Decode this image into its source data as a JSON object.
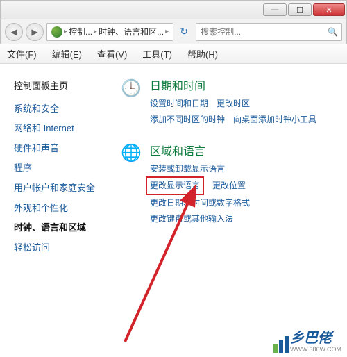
{
  "titlebar": {
    "min": "—",
    "max": "☐",
    "close": "✕"
  },
  "nav": {
    "back": "◀",
    "fwd": "▶",
    "bc1": "控制...",
    "bc2": "时钟、语言和区...",
    "refresh": "↻",
    "search_ph": "搜索控制..."
  },
  "menu": {
    "file": "文件(F)",
    "edit": "编辑(E)",
    "view": "查看(V)",
    "tools": "工具(T)",
    "help": "帮助(H)"
  },
  "sidebar": {
    "home": "控制面板主页",
    "items": [
      {
        "label": "系统和安全"
      },
      {
        "label": "网络和 Internet"
      },
      {
        "label": "硬件和声音"
      },
      {
        "label": "程序"
      },
      {
        "label": "用户帐户和家庭安全"
      },
      {
        "label": "外观和个性化"
      },
      {
        "label": "时钟、语言和区域",
        "active": true
      },
      {
        "label": "轻松访问"
      }
    ]
  },
  "sections": [
    {
      "icon": "🕒",
      "title": "日期和时间",
      "links": [
        {
          "label": "设置时间和日期"
        },
        {
          "label": "更改时区"
        },
        {
          "label": "添加不同时区的时钟"
        },
        {
          "label": "向桌面添加时钟小工具"
        }
      ]
    },
    {
      "icon": "🌐",
      "title": "区域和语言",
      "links": [
        {
          "label": "安装或卸载显示语言"
        },
        {
          "label": "更改显示语言",
          "hl": true
        },
        {
          "label": "更改位置"
        },
        {
          "label": "更改日期、时间或数字格式"
        },
        {
          "label": "更改键盘或其他输入法"
        }
      ]
    }
  ],
  "watermark": {
    "text": "乡巴佬",
    "url": "WWW.386W.COM"
  }
}
